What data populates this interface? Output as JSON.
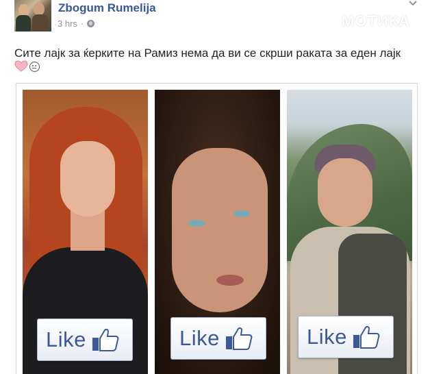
{
  "post": {
    "page_name": "Zbogum Rumelija",
    "timestamp": "3 hrs",
    "separator": "·",
    "privacy_icon": "globe-icon",
    "options_icon": "chevron-down-icon",
    "watermark": "МОТИКА",
    "text": "Сите лајк за ќерките на Рамиз нема да ви се скрши раката за еден лајк",
    "emojis": [
      "heart-icon",
      "neutral-face-icon"
    ]
  },
  "image": {
    "panels": [
      {
        "name": "photo-left",
        "badge_label": "Like",
        "badge_icon": "thumbs-up-icon"
      },
      {
        "name": "photo-center",
        "badge_label": "Like",
        "badge_icon": "thumbs-up-icon"
      },
      {
        "name": "photo-right",
        "badge_label": "Like",
        "badge_icon": "thumbs-up-icon"
      }
    ]
  },
  "colors": {
    "link_blue": "#365899",
    "meta_gray": "#90949c",
    "text_dark": "#1d2129",
    "facebook_blue": "#3b5998",
    "heart_pink": "#f6b7c2"
  }
}
